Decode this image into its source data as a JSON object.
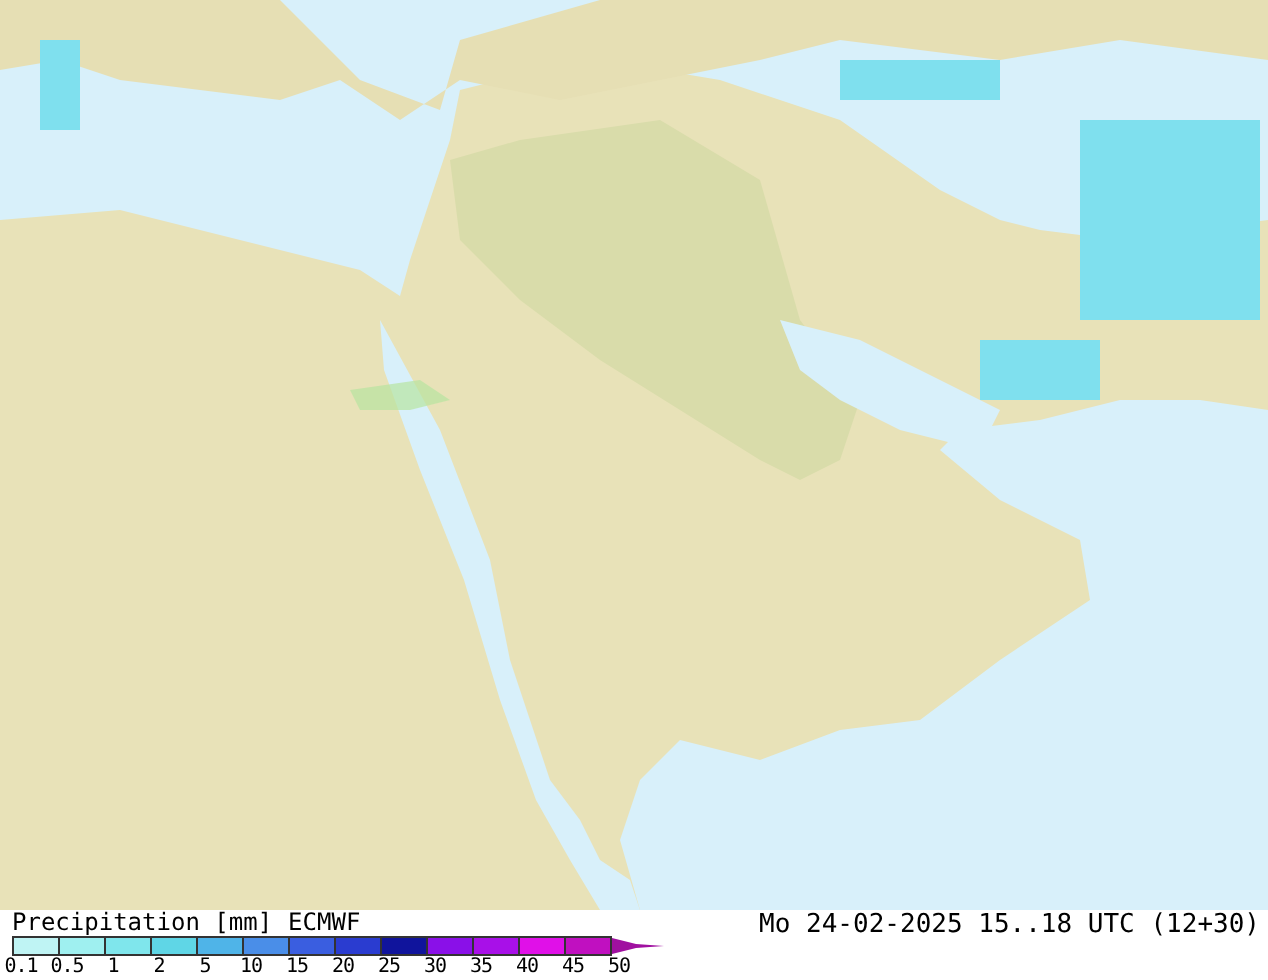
{
  "legend": {
    "title": "Precipitation [mm]",
    "model": "ECMWF",
    "swatches": [
      {
        "color": "#bff4f4"
      },
      {
        "color": "#9ff0f0"
      },
      {
        "color": "#7fe6ec"
      },
      {
        "color": "#5fd6e6"
      },
      {
        "color": "#4fb4e8"
      },
      {
        "color": "#4a8ee8"
      },
      {
        "color": "#3a5ee0"
      },
      {
        "color": "#2a3cd0"
      },
      {
        "color": "#10149c"
      },
      {
        "color": "#8a10e8"
      },
      {
        "color": "#a810e8"
      },
      {
        "color": "#e010e8"
      },
      {
        "color": "#c010c0"
      }
    ],
    "ticks": [
      "0.1",
      "0.5",
      "1",
      "2",
      "5",
      "10",
      "15",
      "20",
      "25",
      "30",
      "35",
      "40",
      "45",
      "50"
    ]
  },
  "valid_time": "Mo 24-02-2025 15..18 UTC (12+30)"
}
